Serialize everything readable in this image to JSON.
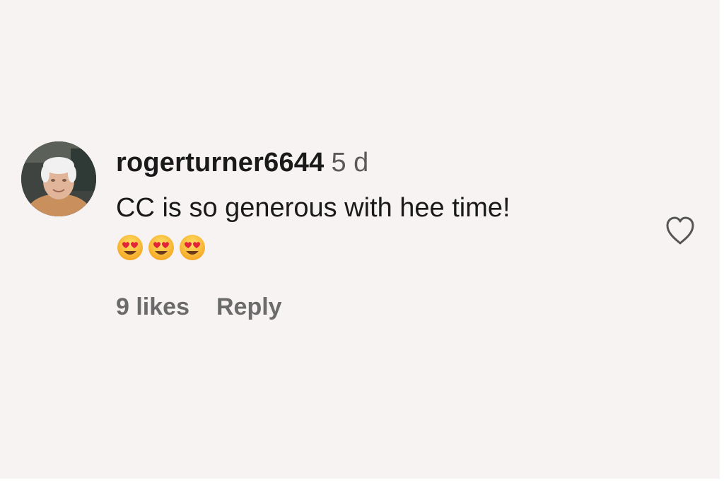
{
  "comment": {
    "username": "rogerturner6644",
    "timestamp": "5 d",
    "text": "CC is so generous with hee time!",
    "emojis": [
      "smiling-face-with-heart-eyes",
      "smiling-face-with-heart-eyes",
      "smiling-face-with-heart-eyes"
    ],
    "likes_label": "9 likes",
    "reply_label": "Reply",
    "like_icon": "heart-outline-icon"
  },
  "colors": {
    "background": "#f8f3f3",
    "text_primary": "#1a1a1a",
    "text_secondary": "#6b6b6b"
  }
}
